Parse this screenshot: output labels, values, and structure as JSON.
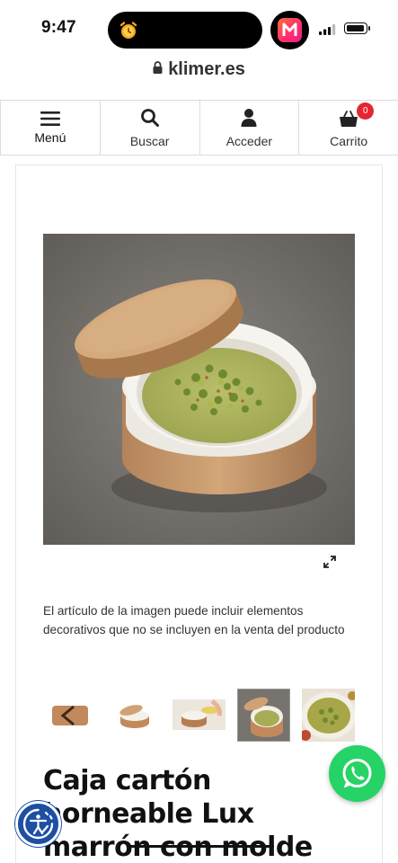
{
  "status_bar": {
    "time": "9:47"
  },
  "browser": {
    "url": "klimer.es"
  },
  "nav": {
    "items": [
      {
        "label": "Menú",
        "icon": "hamburger-icon"
      },
      {
        "label": "Buscar",
        "icon": "search-icon"
      },
      {
        "label": "Acceder",
        "icon": "user-icon"
      },
      {
        "label": "Carrito",
        "icon": "cart-icon",
        "badge": "0"
      }
    ]
  },
  "product": {
    "disclaimer": "El artículo de la imagen puede incluir elementos decorativos que no se incluyen en la venta del producto",
    "title_line_1": "Caja cartón",
    "title_line_2": "horneable Lux",
    "title_line_3": "marrón con molde",
    "thumbnail_count": 5,
    "selected_thumbnail": 4
  },
  "colors": {
    "accent_badge": "#e3262f",
    "whatsapp": "#26d366",
    "accessibility": "#1e4fa3"
  }
}
